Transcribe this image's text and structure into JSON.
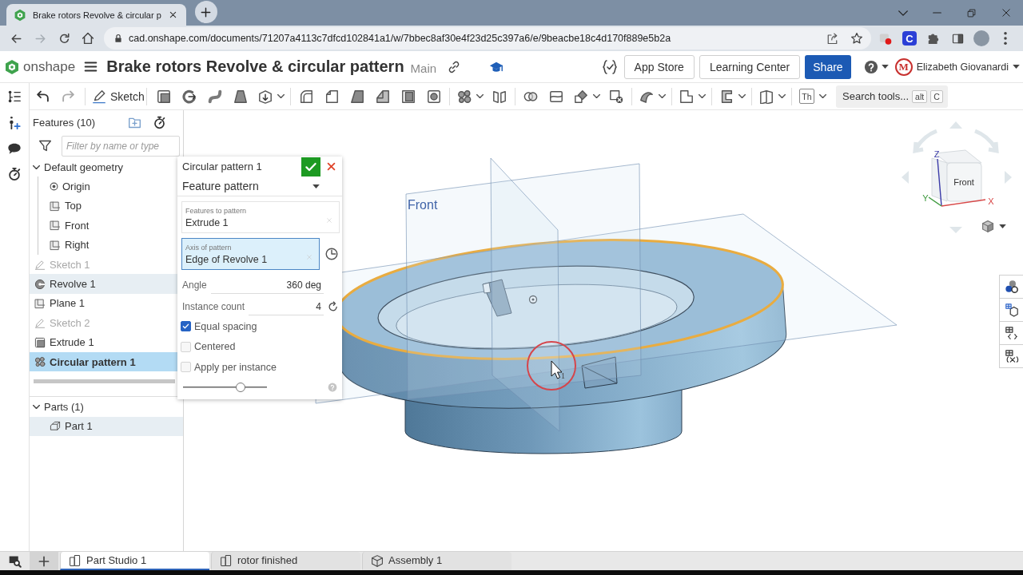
{
  "browser": {
    "tabs": [
      {
        "title": "Brake rotors Revolve & circular p",
        "selected": true
      }
    ],
    "url": "cad.onshape.com/documents/71207a4113c7dfcd102841a1/w/7bbec8af30e4f23d25c397a6/e/9beacbe18c4d170f889e5b2a",
    "extension_badge": "C"
  },
  "header": {
    "logo": "onshape",
    "title": "Brake rotors Revolve & circular pattern",
    "workspace": "Main",
    "links": [
      "App Store",
      "Learning Center"
    ],
    "share": "Share",
    "user": {
      "initial": "M",
      "name": "Elizabeth Giovanardi"
    }
  },
  "toolbar": {
    "sketch": "Sketch",
    "text_tool": "Th",
    "search": {
      "placeholder": "Search tools...",
      "keys": [
        "alt",
        "C"
      ]
    }
  },
  "features": {
    "title": "Features (10)",
    "filter": {
      "placeholder": "Filter by name or type"
    },
    "items": [
      {
        "label": "Default geometry",
        "kind": "folder",
        "expanded": true,
        "selected": false,
        "highlighted": false,
        "hidden": false,
        "children": [
          {
            "label": "Origin",
            "kind": "origin",
            "selected": false,
            "highlighted": false,
            "hidden": false
          },
          {
            "label": "Top",
            "kind": "plane",
            "selected": false,
            "highlighted": false,
            "hidden": false
          },
          {
            "label": "Front",
            "kind": "plane",
            "selected": false,
            "highlighted": false,
            "hidden": false
          },
          {
            "label": "Right",
            "kind": "plane",
            "selected": false,
            "highlighted": false,
            "hidden": false
          }
        ]
      },
      {
        "label": "Sketch 1",
        "kind": "sketch",
        "selected": false,
        "highlighted": false,
        "hidden": true
      },
      {
        "label": "Revolve 1",
        "kind": "revolve",
        "selected": false,
        "highlighted": true,
        "hidden": false
      },
      {
        "label": "Plane 1",
        "kind": "plane",
        "selected": false,
        "highlighted": false,
        "hidden": false
      },
      {
        "label": "Sketch 2",
        "kind": "sketch",
        "selected": false,
        "highlighted": false,
        "hidden": true
      },
      {
        "label": "Extrude 1",
        "kind": "extrude",
        "selected": false,
        "highlighted": false,
        "hidden": false
      },
      {
        "label": "Circular pattern 1",
        "kind": "pattern",
        "selected": true,
        "highlighted": false,
        "hidden": false
      }
    ]
  },
  "parts": {
    "title": "Parts (1)",
    "expanded": true,
    "items": [
      {
        "label": "Part 1",
        "kind": "part",
        "selected": false,
        "highlighted": true
      }
    ]
  },
  "dialog": {
    "title": "Circular pattern 1",
    "pattern_type": "Feature pattern",
    "selections": [
      {
        "label": "Features to pattern",
        "value": "Extrude 1",
        "kind": "features",
        "active": false
      },
      {
        "label": "Axis of pattern",
        "value": "Edge of Revolve 1",
        "kind": "axis",
        "active": true
      }
    ],
    "parameters": [
      {
        "label": "Angle",
        "value": "360 deg",
        "kind": "angle"
      },
      {
        "label": "Instance count",
        "value": "4",
        "kind": "count"
      }
    ],
    "options": [
      {
        "label": "Equal spacing",
        "checked": true
      },
      {
        "label": "Centered",
        "checked": false
      },
      {
        "label": "Apply per instance",
        "checked": false
      }
    ],
    "slider": {
      "level": 0.69
    }
  },
  "viewport": {
    "plane_label": "Front",
    "cursor_label": "1",
    "view_cube": {
      "face": "Front",
      "axes": [
        {
          "label": "Z",
          "color": "#3b3ba8"
        },
        {
          "label": "Y",
          "color": "#3f9a3f"
        },
        {
          "label": "X",
          "color": "#d84848"
        }
      ]
    }
  },
  "document_tabs": [
    {
      "label": "Part Studio 1",
      "kind": "partstudio",
      "selected": true
    },
    {
      "label": "rotor finished",
      "kind": "partstudio",
      "selected": false
    },
    {
      "label": "Assembly 1",
      "kind": "assembly",
      "selected": false
    }
  ]
}
